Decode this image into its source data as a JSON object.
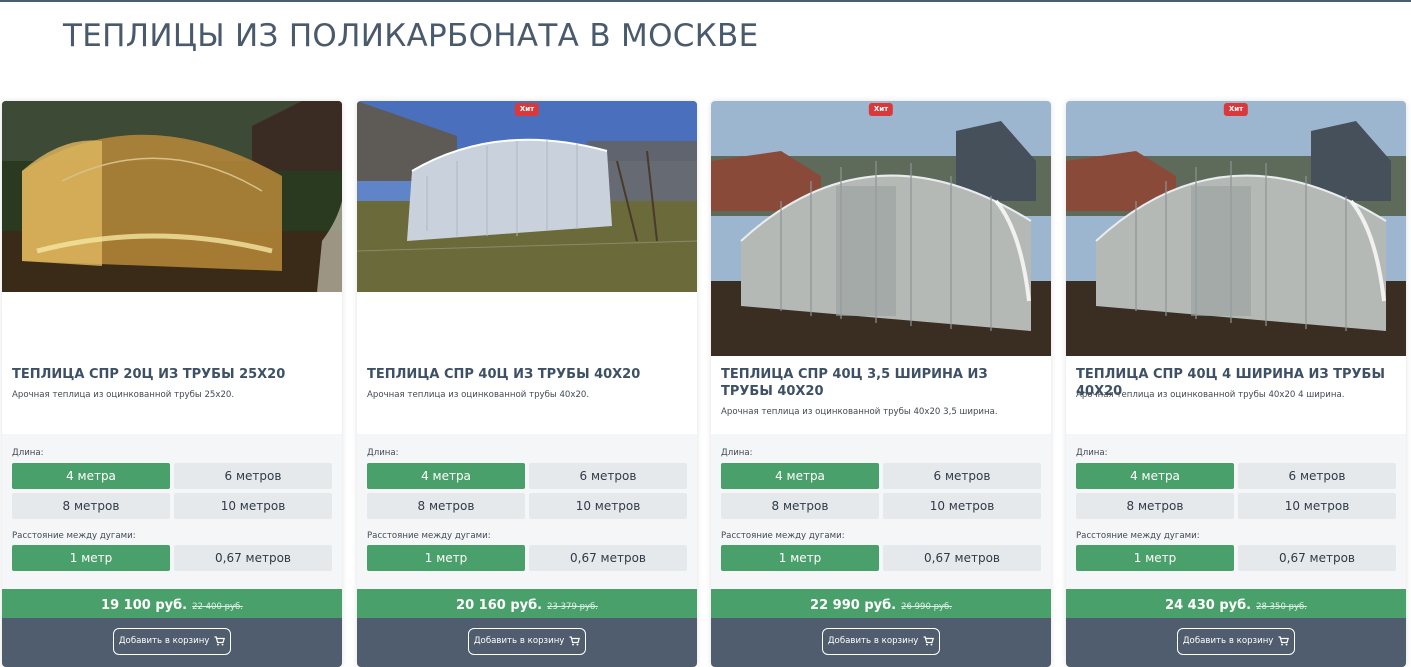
{
  "page": {
    "title": "ТЕПЛИЦЫ ИЗ ПОЛИКАРБОНАТА В МОСКВЕ"
  },
  "colors": {
    "accent": "#4aa06a",
    "dark": "#4f5d6e",
    "badge": "#d9393b"
  },
  "labels": {
    "length": "Длина:",
    "arc_distance": "Расстояние между дугами:",
    "add_to_cart": "Добавить в корзину"
  },
  "cards": [
    {
      "title": "ТЕПЛИЦА СПР 20Ц ИЗ ТРУБЫ 25Х20",
      "desc": "Арочная теплица из оцинкованной трубы 25х20.",
      "badge": "",
      "photo_icon": "greenhouse-photo",
      "lengths": [
        "4 метра",
        "6 метров",
        "8 метров",
        "10 метров"
      ],
      "arc_options": [
        "1 метр",
        "0,67 метров"
      ],
      "price": "19 100 руб.",
      "old_price": "22 400 руб."
    },
    {
      "title": "ТЕПЛИЦА СПР 40Ц ИЗ ТРУБЫ 40Х20",
      "desc": "Арочная теплица из оцинкованной трубы 40х20.",
      "badge": "Хит",
      "photo_icon": "greenhouse-photo",
      "lengths": [
        "4 метра",
        "6 метров",
        "8 метров",
        "10 метров"
      ],
      "arc_options": [
        "1 метр",
        "0,67 метров"
      ],
      "price": "20 160 руб.",
      "old_price": "23 379 руб."
    },
    {
      "title": "ТЕПЛИЦА СПР 40Ц 3,5 ШИРИНА ИЗ ТРУБЫ 40Х20",
      "desc": "Арочная теплица из оцинкованной трубы 40х20 3,5 ширина.",
      "badge": "Хит",
      "photo_icon": "greenhouse-photo",
      "lengths": [
        "4 метра",
        "6 метров",
        "8 метров",
        "10 метров"
      ],
      "arc_options": [
        "1 метр",
        "0,67 метров"
      ],
      "price": "22 990 руб.",
      "old_price": "26 990 руб."
    },
    {
      "title": "ТЕПЛИЦА СПР 40Ц 4 ШИРИНА ИЗ ТРУБЫ 40Х20",
      "desc": "Арочная теплица из оцинкованной трубы 40х20 4 ширина.",
      "badge": "Хит",
      "photo_icon": "greenhouse-photo",
      "lengths": [
        "4 метра",
        "6 метров",
        "8 метров",
        "10 метров"
      ],
      "arc_options": [
        "1 метр",
        "0,67 метров"
      ],
      "price": "24 430 руб.",
      "old_price": "28 350 руб."
    }
  ]
}
